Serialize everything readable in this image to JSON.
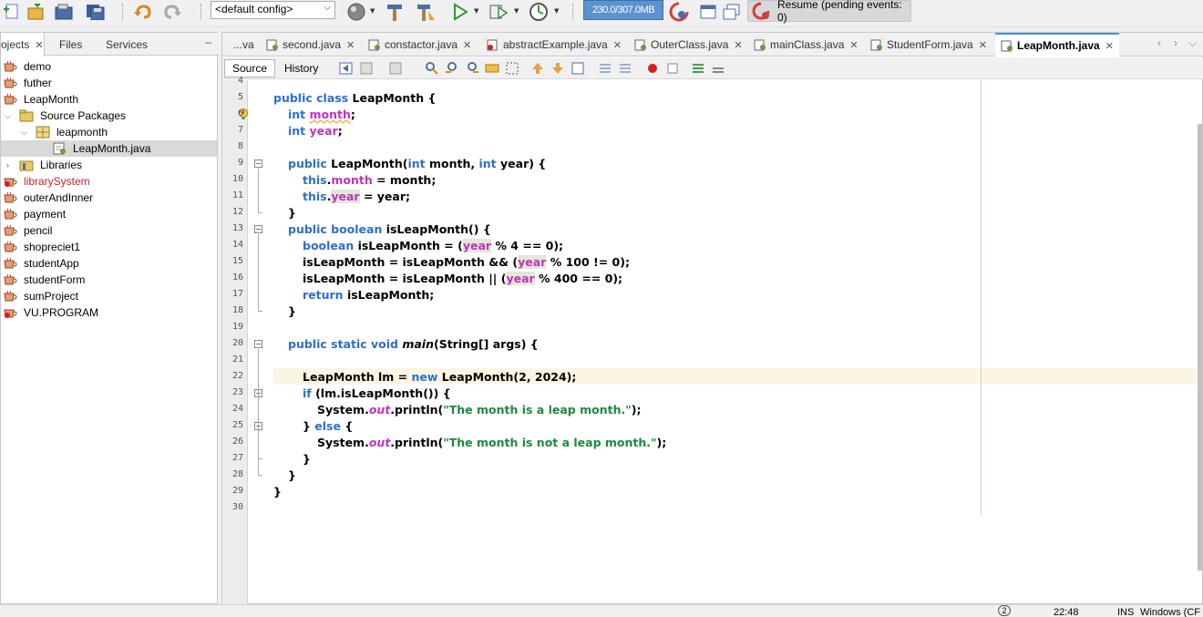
{
  "toolbar": {
    "config_select": "<default config>",
    "memory": "230.0/307.0MB",
    "resume": "Resume (pending events: 0)"
  },
  "projects_panel": {
    "tabs": [
      {
        "label": "ojects",
        "active": true
      },
      {
        "label": "Files",
        "active": false
      },
      {
        "label": "Services",
        "active": false
      }
    ],
    "minimize": "–",
    "tree": [
      {
        "label": "demo",
        "type": "project"
      },
      {
        "label": "futher",
        "type": "project"
      },
      {
        "label": "LeapMonth",
        "type": "project"
      },
      {
        "label": "Source Packages",
        "type": "folder"
      },
      {
        "label": "leapmonth",
        "type": "package"
      },
      {
        "label": "LeapMonth.java",
        "type": "file"
      },
      {
        "label": "Libraries",
        "type": "library"
      },
      {
        "label": "librarySystem",
        "type": "project-error"
      },
      {
        "label": "outerAndInner",
        "type": "project"
      },
      {
        "label": "payment",
        "type": "project"
      },
      {
        "label": "pencil",
        "type": "project"
      },
      {
        "label": "shopreciet1",
        "type": "project"
      },
      {
        "label": "studentApp",
        "type": "project"
      },
      {
        "label": "studentForm",
        "type": "project"
      },
      {
        "label": "sumProject",
        "type": "project"
      },
      {
        "label": "VU.PROGRAM",
        "type": "project-error"
      }
    ]
  },
  "editor": {
    "tabs": [
      {
        "label": "...va",
        "active": false
      },
      {
        "label": "second.java",
        "active": false
      },
      {
        "label": "constactor.java",
        "active": false
      },
      {
        "label": "abstractExample.java",
        "active": false
      },
      {
        "label": "OuterClass.java",
        "active": false
      },
      {
        "label": "mainClass.java",
        "active": false
      },
      {
        "label": "StudentForm.java",
        "active": false
      },
      {
        "label": "LeapMonth.java",
        "active": true
      }
    ],
    "source_button": "Source",
    "history_button": "History",
    "line_numbers": [
      "4",
      "5",
      "6",
      "7",
      "8",
      "9",
      "10",
      "11",
      "12",
      "13",
      "14",
      "15",
      "16",
      "17",
      "18",
      "19",
      "20",
      "21",
      "22",
      "23",
      "24",
      "25",
      "26",
      "27",
      "28",
      "29",
      "30"
    ],
    "code": {
      "l5_kw": "public class ",
      "l5_rest": "LeapMonth {",
      "l6_kw": "int ",
      "l6_f": "month",
      "l6_e": ";",
      "l7_kw": "int ",
      "l7_f": "year",
      "l7_e": ";",
      "l9_kw": "public ",
      "l9_a": "LeapMonth(",
      "l9_kw2": "int ",
      "l9_b": "month, ",
      "l9_kw3": "int ",
      "l9_c": "year) {",
      "l10_kw": "this",
      "l10_a": ".",
      "l10_f": "month",
      "l10_b": " = month;",
      "l11_kw": "this",
      "l11_a": ".",
      "l11_f": "year",
      "l11_b": " = year;",
      "l12": "}",
      "l13_kw": "public boolean ",
      "l13_a": "isLeapMonth() {",
      "l14_kw": "boolean ",
      "l14_a": "isLeapMonth = (",
      "l14_f": "year",
      "l14_b": " % 4 == 0);",
      "l15_a": "isLeapMonth = isLeapMonth && (",
      "l15_f": "year",
      "l15_b": " % 100 != 0);",
      "l16_a": "isLeapMonth = isLeapMonth || (",
      "l16_f": "year",
      "l16_b": " % 400 == 0);",
      "l17_kw": "return ",
      "l17_a": "isLeapMonth;",
      "l18": "}",
      "l20_kw": "public static void ",
      "l20_m": "main",
      "l20_a": "(String[] args) {",
      "l22_a": "LeapMonth lm = ",
      "l22_kw": "new ",
      "l22_b": "LeapMonth(2, 2024);",
      "l23_kw": "if ",
      "l23_a": "(lm.isLeapMonth()) {",
      "l24_a": "System.",
      "l24_o": "out",
      "l24_b": ".println(",
      "l24_s": "\"The month is a leap month.\"",
      "l24_c": ");",
      "l25_a": "} ",
      "l25_kw": "else ",
      "l25_b": "{",
      "l26_a": "System.",
      "l26_o": "out",
      "l26_b": ".println(",
      "l26_s": "\"The month is not a leap month.\"",
      "l26_c": ");",
      "l27": "}",
      "l28": "}",
      "l29": "}"
    }
  },
  "status": {
    "notifications": "2",
    "position": "22:48",
    "mode": "INS",
    "line_ending": "Windows (CF"
  },
  "colors": {
    "keyword": "#2d6fd1",
    "field": "#c032c0",
    "string": "#1d8a3d",
    "memory_bar": "#5b92cf",
    "current_line": "#faf6e3"
  }
}
